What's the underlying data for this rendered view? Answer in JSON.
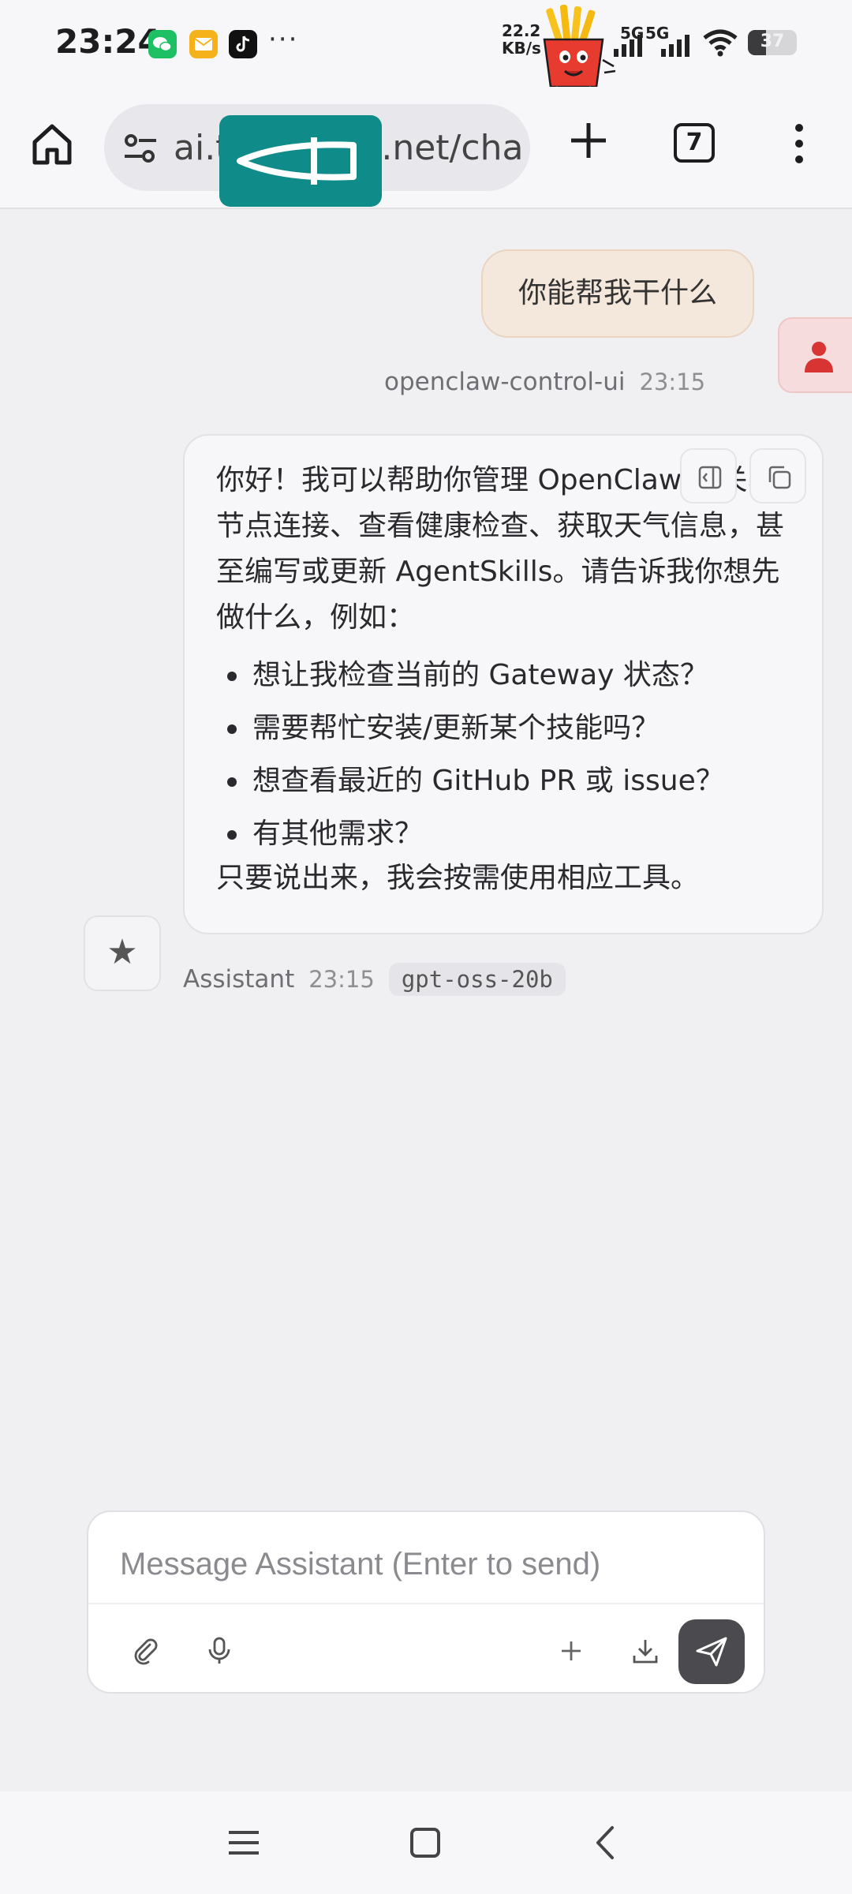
{
  "status_bar": {
    "time": "23:24",
    "notification_icons": [
      "wechat-icon",
      "mail-icon",
      "tiktok-icon"
    ],
    "more": "···",
    "net_speed_value": "22.2",
    "net_speed_unit": "KB/s",
    "network_1": "5G",
    "network_2": "5G",
    "battery": "37",
    "battery_level": 0.37
  },
  "browser": {
    "url_start": "ai.t",
    "url_end": "s.net/cha",
    "tab_count": "7",
    "icons": [
      "home-icon",
      "tune-icon",
      "plus-icon",
      "tabs-icon",
      "more-vert-icon"
    ]
  },
  "chat": {
    "user_message": {
      "text": "你能帮我干什么",
      "sender": "openclaw-control-ui",
      "time": "23:15"
    },
    "assistant_message": {
      "intro": "你好！我可以帮助你管理 OpenClaw 网关、节点连接、查看健康检查、获取天气信息，甚至编写或更新 AgentSkills。请告诉我你想先做什么，例如：",
      "bullets": [
        "想让我检查当前的 Gateway 状态？",
        "需要帮忙安装/更新某个技能吗？",
        "想查看最近的 GitHub PR 或 issue？",
        "有其他需求？"
      ],
      "outro": "只要说出来，我会按需使用相应工具。",
      "sender": "Assistant",
      "time": "23:15",
      "model": "gpt-oss-20b",
      "avatar_glyph": "★"
    }
  },
  "composer": {
    "placeholder": "Message Assistant (Enter to send)",
    "value": ""
  },
  "colors": {
    "user_bubble": "#f4e7dc",
    "send_button": "#4a4a4f",
    "redaction": "#0f8c8a",
    "user_avatar": "#d93434"
  }
}
